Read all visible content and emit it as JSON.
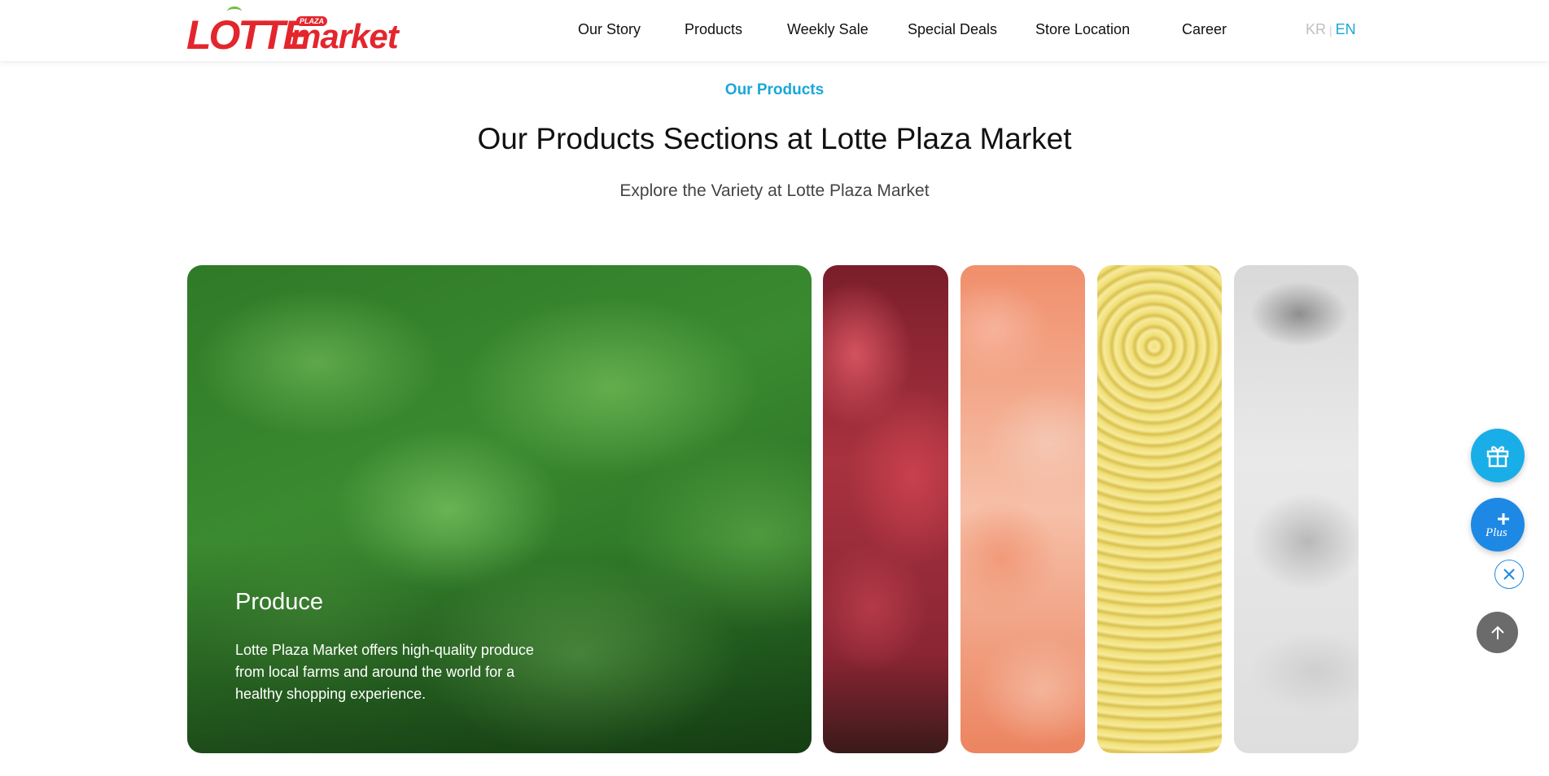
{
  "header": {
    "logo": {
      "main": "LOTTE",
      "sub": "market",
      "badge": "PLAZA"
    },
    "nav": [
      "Our Story",
      "Products",
      "Weekly Sale",
      "Special Deals",
      "Store Location",
      "Career"
    ],
    "lang": {
      "kr": "KR",
      "sep": "|",
      "en": "EN"
    }
  },
  "section": {
    "eyebrow": "Our Products",
    "title": "Our Products Sections at Lotte Plaza Market",
    "subtitle": "Explore the Variety at Lotte Plaza Market"
  },
  "panels": [
    {
      "title": "Produce",
      "description": "Lotte Plaza Market offers high-quality produce from local farms and around the world for a healthy shopping experience."
    }
  ],
  "floating": {
    "gift_icon": "gift-icon",
    "plus_icon": "plus-icon",
    "plus_label": "Plus",
    "close_icon": "close-icon",
    "top_icon": "arrow-up-icon"
  },
  "colors": {
    "brand_red": "#e3262d",
    "accent_blue": "#1aa7d8",
    "fab_blue": "#1e88e5"
  }
}
